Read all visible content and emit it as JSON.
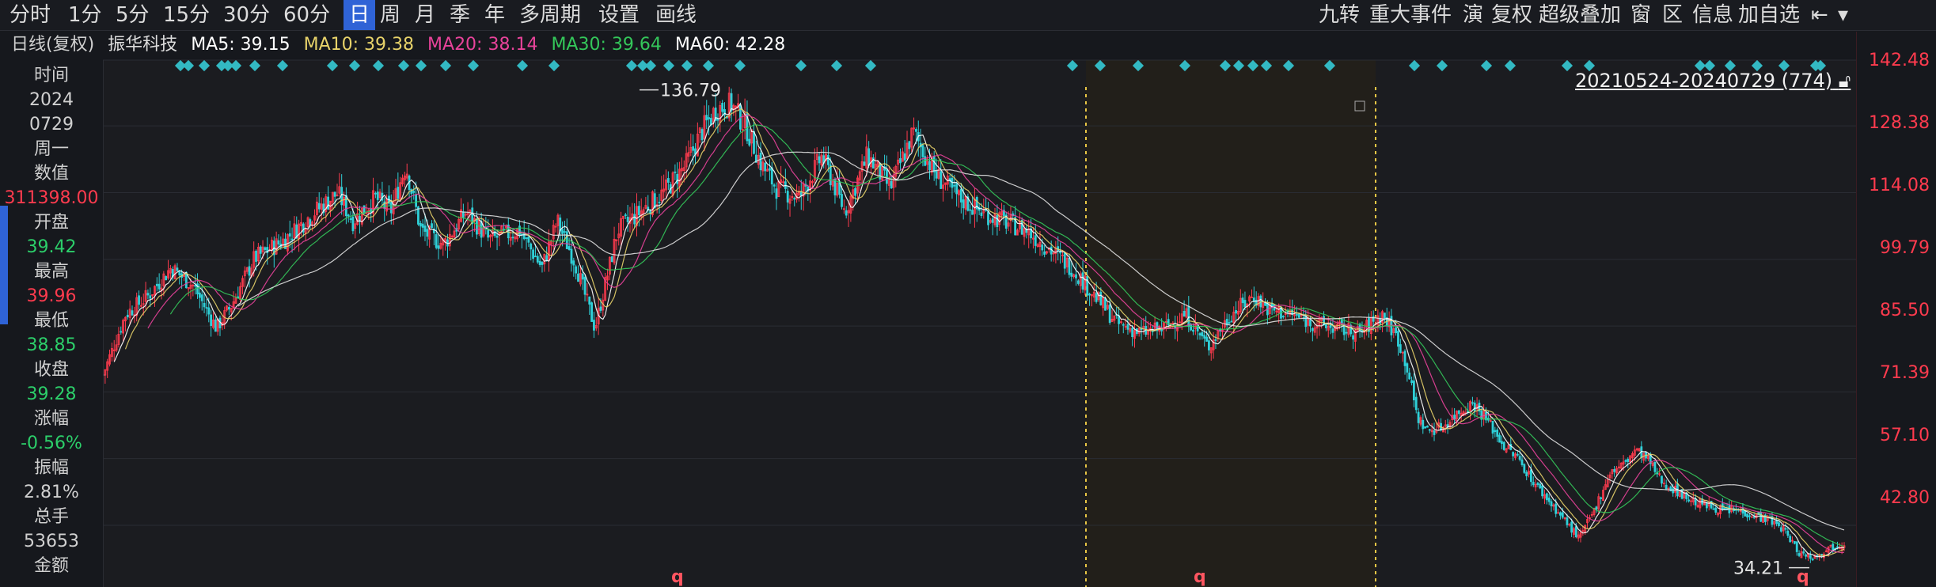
{
  "toolbar": {
    "periods": [
      "分时",
      "1分",
      "5分",
      "15分",
      "30分",
      "60分",
      "日",
      "周",
      "月",
      "季",
      "年",
      "多周期"
    ],
    "active_period": "日",
    "settings_label": "设置",
    "draw_label": "画线",
    "right_items": [
      "九转",
      "重大事件",
      "演",
      "复权",
      "超级叠加",
      "窗",
      "区",
      "信息",
      "加自选"
    ]
  },
  "info": {
    "period_label": "日线(复权)",
    "stock_name": "振华科技",
    "ma5": "MA5: 39.15",
    "ma10": "MA10: 39.38",
    "ma20": "MA20: 38.14",
    "ma30": "MA30: 39.64",
    "ma60": "MA60: 42.28",
    "colors": {
      "ma5": "#ffffff",
      "ma10": "#e8d36a",
      "ma20": "#e8439a",
      "ma30": "#34c75a",
      "ma60": "#ffffff"
    }
  },
  "quote": {
    "time_label": "时间",
    "year": "2024",
    "date": "0729",
    "weekday": "周一",
    "value_label": "数值",
    "value": "311398.00",
    "open_label": "开盘",
    "open": "39.42",
    "high_label": "最高",
    "high": "39.96",
    "low_label": "最低",
    "low": "38.85",
    "close_label": "收盘",
    "close": "39.28",
    "change_label": "涨幅",
    "change": "-0.56%",
    "amp_label": "振幅",
    "amp": "2.81%",
    "vol_label": "总手",
    "vol": "53653",
    "amount_label": "金额"
  },
  "price_axis": [
    "142.48",
    "128.38",
    "114.08",
    "99.79",
    "85.50",
    "71.39",
    "57.10",
    "42.80"
  ],
  "date_range": "20210524-20240729 (774)",
  "annotations": {
    "high_marker": "136.79",
    "low_marker": "34.21",
    "q_marker": "q"
  },
  "chart_data": {
    "type": "candlestick",
    "title": "振华科技 日线(复权)",
    "ylim": [
      34,
      148
    ],
    "y_ticks": [
      142.48,
      128.38,
      114.08,
      99.79,
      85.5,
      71.39,
      57.1,
      42.8
    ],
    "range_start": "20210524",
    "range_end": "20240729",
    "bar_count": 774,
    "highest": 136.79,
    "lowest": 34.21,
    "price_path": [
      [
        0,
        75
      ],
      [
        15,
        88
      ],
      [
        30,
        92
      ],
      [
        45,
        98
      ],
      [
        60,
        94
      ],
      [
        75,
        85
      ],
      [
        85,
        90
      ],
      [
        100,
        100
      ],
      [
        120,
        104
      ],
      [
        140,
        110
      ],
      [
        155,
        114
      ],
      [
        165,
        108
      ],
      [
        180,
        113
      ],
      [
        190,
        110
      ],
      [
        200,
        120
      ],
      [
        210,
        106
      ],
      [
        225,
        103
      ],
      [
        240,
        110
      ],
      [
        255,
        104
      ],
      [
        275,
        106
      ],
      [
        290,
        98
      ],
      [
        300,
        108
      ],
      [
        312,
        99
      ],
      [
        325,
        85
      ],
      [
        340,
        106
      ],
      [
        355,
        110
      ],
      [
        370,
        114
      ],
      [
        385,
        120
      ],
      [
        395,
        127
      ],
      [
        405,
        132
      ],
      [
        415,
        133
      ],
      [
        425,
        128
      ],
      [
        435,
        120
      ],
      [
        445,
        115
      ],
      [
        460,
        113
      ],
      [
        475,
        122
      ],
      [
        490,
        110
      ],
      [
        505,
        122
      ],
      [
        520,
        115
      ],
      [
        535,
        127
      ],
      [
        550,
        118
      ],
      [
        565,
        113
      ],
      [
        580,
        110
      ],
      [
        595,
        108
      ],
      [
        610,
        106
      ],
      [
        625,
        102
      ],
      [
        640,
        98
      ],
      [
        655,
        92
      ],
      [
        670,
        86
      ],
      [
        685,
        84
      ],
      [
        700,
        85
      ],
      [
        715,
        88
      ],
      [
        730,
        81
      ],
      [
        745,
        88
      ],
      [
        760,
        92
      ],
      [
        770,
        89
      ],
      [
        785,
        88
      ],
      [
        800,
        86
      ],
      [
        815,
        85
      ],
      [
        830,
        84
      ],
      [
        845,
        88
      ],
      [
        855,
        83
      ],
      [
        862,
        76
      ],
      [
        868,
        66
      ],
      [
        875,
        63
      ],
      [
        885,
        64
      ],
      [
        895,
        67
      ],
      [
        905,
        69
      ],
      [
        915,
        65
      ],
      [
        925,
        60
      ],
      [
        935,
        57
      ],
      [
        945,
        52
      ],
      [
        955,
        48
      ],
      [
        965,
        44
      ],
      [
        975,
        40
      ],
      [
        985,
        46
      ],
      [
        995,
        54
      ],
      [
        1005,
        56
      ],
      [
        1012,
        59
      ],
      [
        1020,
        57
      ],
      [
        1030,
        52
      ],
      [
        1040,
        50
      ],
      [
        1050,
        48
      ],
      [
        1060,
        47
      ],
      [
        1070,
        46
      ],
      [
        1080,
        46
      ],
      [
        1090,
        45
      ],
      [
        1100,
        44
      ],
      [
        1110,
        42
      ],
      [
        1120,
        37
      ],
      [
        1130,
        36
      ],
      [
        1140,
        38
      ],
      [
        1150,
        39
      ]
    ],
    "ma_lines": [
      "MA5",
      "MA10",
      "MA20",
      "MA30",
      "MA60"
    ],
    "shaded_region": "highlighted interval"
  }
}
